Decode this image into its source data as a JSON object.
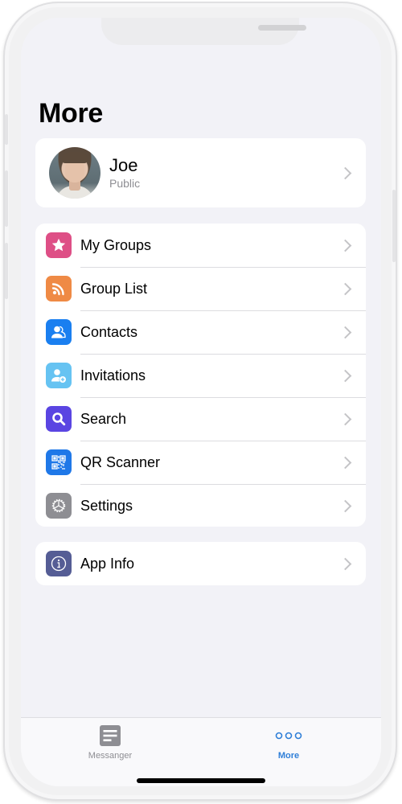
{
  "page": {
    "title": "More"
  },
  "profile": {
    "name": "Joe",
    "status": "Public",
    "avatar_icon": "user-avatar-photo"
  },
  "menu": {
    "items": [
      {
        "label": "My Groups",
        "icon": "star-icon",
        "color": "#de4f86"
      },
      {
        "label": "Group List",
        "icon": "rss-feed-icon",
        "color": "#ef8a45"
      },
      {
        "label": "Contacts",
        "icon": "contacts-icon",
        "color": "#1a7ff0"
      },
      {
        "label": "Invitations",
        "icon": "add-person-icon",
        "color": "#66c3f2"
      },
      {
        "label": "Search",
        "icon": "magnifier-icon",
        "color": "#5a45e2"
      },
      {
        "label": "QR Scanner",
        "icon": "qr-code-icon",
        "color": "#1f78e8"
      },
      {
        "label": "Settings",
        "icon": "gear-icon",
        "color": "#8e8e93"
      }
    ]
  },
  "info": {
    "items": [
      {
        "label": "App Info",
        "icon": "info-icon",
        "color": "#555d95"
      }
    ]
  },
  "tab_bar": {
    "tabs": [
      {
        "label": "Messanger",
        "icon": "document-icon",
        "active": false,
        "color": "#8e8e93"
      },
      {
        "label": "More",
        "icon": "more-dots-icon",
        "active": true,
        "color": "#2f7fd8"
      }
    ]
  }
}
